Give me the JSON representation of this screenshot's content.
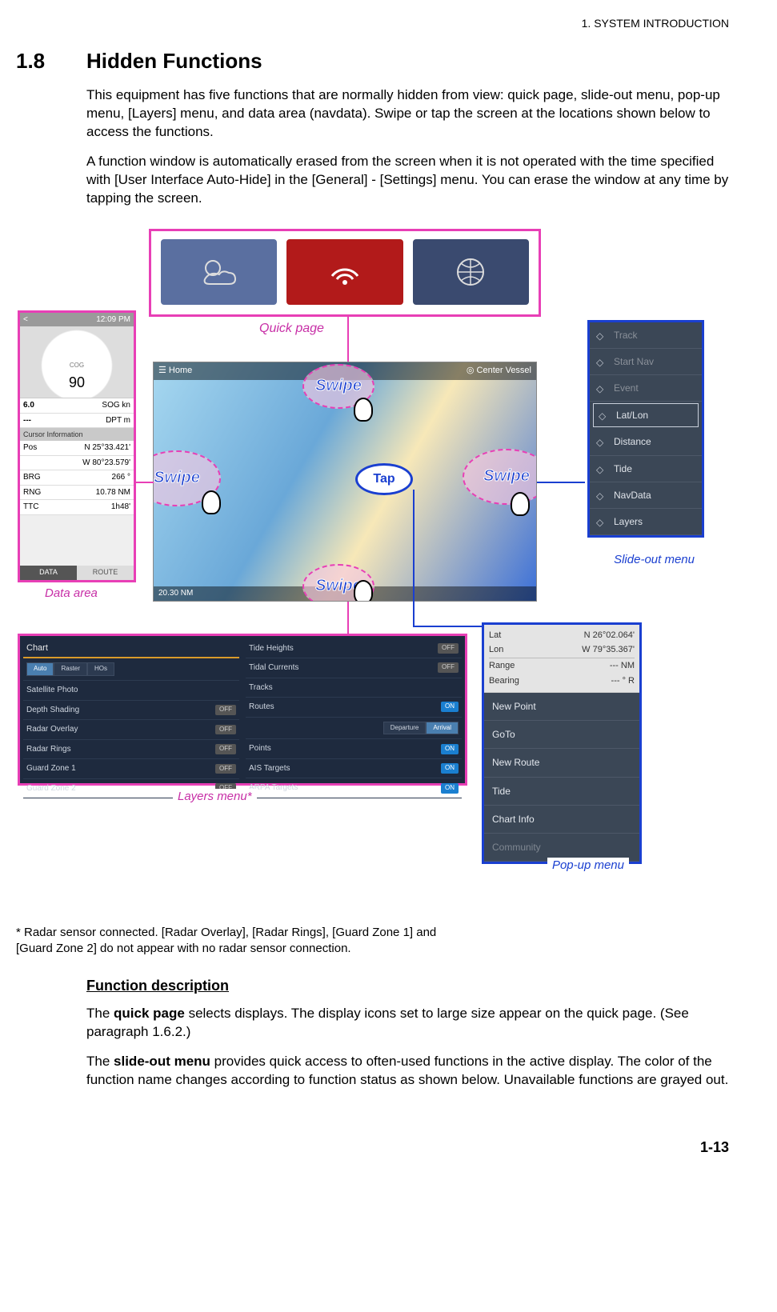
{
  "header": {
    "chapter": "1.  SYSTEM INTRODUCTION"
  },
  "section": {
    "number": "1.8",
    "title": "Hidden Functions"
  },
  "paragraphs": {
    "p1": "This equipment has five functions that are normally hidden from view: quick page, slide-out menu, pop-up menu, [Layers] menu, and data area (navdata). Swipe or tap the screen at the locations shown below to access the functions.",
    "p2": "A function window is automatically erased from the screen when it is not operated with the time specified with [User Interface Auto-Hide] in the [General] - [Settings] menu. You can erase the window at any time by tapping the screen."
  },
  "labels": {
    "quick_page": "Quick page",
    "data_area": "Data area",
    "slide_out": "Slide-out menu",
    "layers_menu": "Layers menu*",
    "popup_menu": "Pop-up menu",
    "swipe": "Swipe",
    "tap": "Tap"
  },
  "map": {
    "home": "Home",
    "center": "Center Vessel",
    "scale": "20.30   NM"
  },
  "data_area": {
    "time": "12:09 PM",
    "cog_label": "COG",
    "cog_value": "90",
    "sog_label": "SOG kn",
    "sog_value": "6.0",
    "dpt_label": "DPT m",
    "dpt_value": "---",
    "cursor_title": "Cursor Information",
    "rows": [
      {
        "k": "Pos",
        "v": "N 25°33.421'"
      },
      {
        "k": "",
        "v": "W 80°23.579'"
      },
      {
        "k": "BRG",
        "v": "266 °"
      },
      {
        "k": "RNG",
        "v": "10.78 NM"
      },
      {
        "k": "TTC",
        "v": "1h48'"
      }
    ],
    "tab_active": "DATA",
    "tab_inactive": "ROUTE"
  },
  "slide_out": {
    "items": [
      {
        "label": "Track",
        "dim": true
      },
      {
        "label": "Start Nav",
        "dim": true
      },
      {
        "label": "Event",
        "dim": true
      },
      {
        "label": "Lat/Lon",
        "box": true
      },
      {
        "label": "Distance"
      },
      {
        "label": "Tide"
      },
      {
        "label": "NavData"
      },
      {
        "label": "Layers"
      }
    ]
  },
  "layers": {
    "left_head": "Chart",
    "seg": [
      "Auto",
      "Raster",
      "HOs"
    ],
    "left": [
      {
        "label": "Satellite Photo",
        "state": ""
      },
      {
        "label": "Depth Shading",
        "state": "OFF"
      },
      {
        "label": "Radar Overlay",
        "state": "OFF"
      },
      {
        "label": "Radar Rings",
        "state": "OFF"
      },
      {
        "label": "Guard Zone 1",
        "state": "OFF"
      },
      {
        "label": "Guard Zone 2",
        "state": "OFF"
      }
    ],
    "right": [
      {
        "label": "Tide Heights",
        "state": "OFF"
      },
      {
        "label": "Tidal Currents",
        "state": "OFF"
      },
      {
        "label": "Tracks",
        "state": ""
      },
      {
        "label": "Routes",
        "state": "ON"
      },
      {
        "label": "_seg",
        "a": "Departure",
        "b": "Arrival"
      },
      {
        "label": "Points",
        "state": "ON"
      },
      {
        "label": "AIS Targets",
        "state": "ON"
      },
      {
        "label": "ARPA Targets",
        "state": "ON"
      }
    ]
  },
  "popup": {
    "head": [
      {
        "k": "Lat",
        "v": "N 26°02.064'"
      },
      {
        "k": "Lon",
        "v": "W 79°35.367'"
      },
      {
        "k": "Range",
        "v": "--- NM"
      },
      {
        "k": "Bearing",
        "v": "--- ° R"
      }
    ],
    "items": [
      "New Point",
      "GoTo",
      "New Route",
      "Tide",
      "Chart Info",
      "Community"
    ]
  },
  "footnote": "* Radar sensor connected. [Radar Overlay], [Radar Rings], [Guard Zone 1] and [Guard Zone 2] do not appear with no radar sensor connection.",
  "subhead": "Function description",
  "desc1a": "The ",
  "desc1b": "quick page",
  "desc1c": " selects displays. The display icons set to large size appear on the quick page. (See paragraph 1.6.2.)",
  "desc2a": "The ",
  "desc2b": "slide-out menu",
  "desc2c": " provides quick access to often-used functions in the active display. The color of the function name changes according to function status as shown below. Unavailable functions are grayed out.",
  "page": "1-13"
}
